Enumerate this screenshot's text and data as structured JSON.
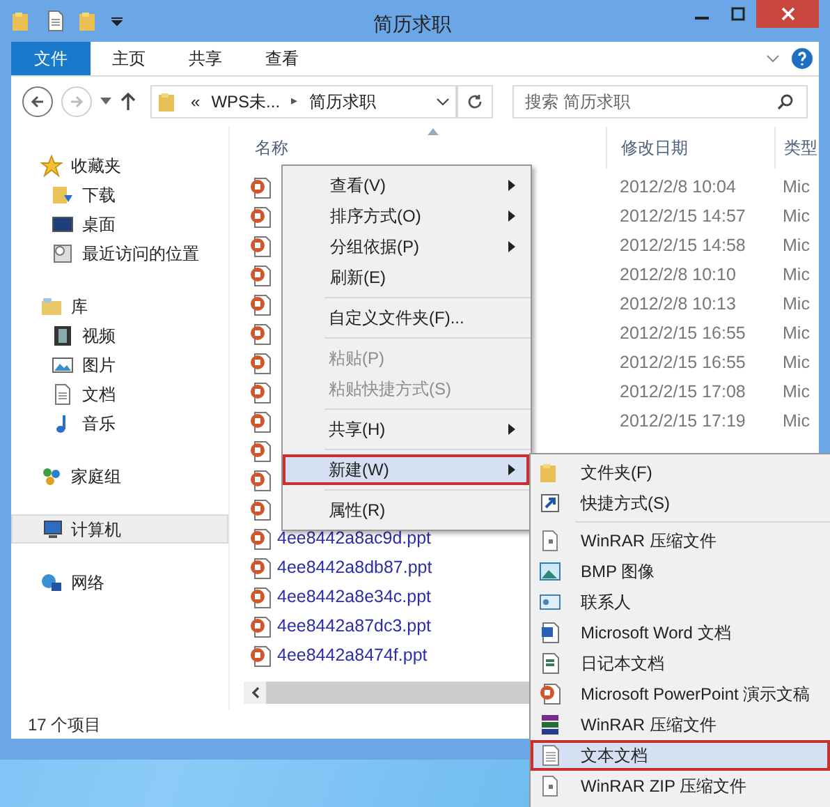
{
  "window": {
    "title": "简历求职"
  },
  "ribbon": {
    "tabs": [
      {
        "label": "文件",
        "selected": true
      },
      {
        "label": "主页",
        "selected": false
      },
      {
        "label": "共享",
        "selected": false
      },
      {
        "label": "查看",
        "selected": false
      }
    ]
  },
  "address": {
    "overflow": "«",
    "crumbs": [
      "WPS未...",
      "简历求职"
    ],
    "separator": "▸",
    "search_placeholder": "搜索 简历求职"
  },
  "nav": [
    {
      "label": "收藏夹",
      "kind": "star",
      "selected": false,
      "children": [
        {
          "label": "下载",
          "kind": "download",
          "selected": false
        },
        {
          "label": "桌面",
          "kind": "desktop",
          "selected": false
        },
        {
          "label": "最近访问的位置",
          "kind": "recent",
          "selected": false
        }
      ]
    },
    {
      "label": "库",
      "kind": "library",
      "selected": false,
      "children": [
        {
          "label": "视频",
          "kind": "video",
          "selected": false
        },
        {
          "label": "图片",
          "kind": "picture",
          "selected": false
        },
        {
          "label": "文档",
          "kind": "document",
          "selected": false
        },
        {
          "label": "音乐",
          "kind": "music",
          "selected": false
        }
      ]
    },
    {
      "label": "家庭组",
      "kind": "homegroup",
      "selected": false
    },
    {
      "label": "计算机",
      "kind": "computer",
      "selected": true
    },
    {
      "label": "网络",
      "kind": "network",
      "selected": false
    }
  ],
  "columns": [
    "名称",
    "修改日期",
    "类型"
  ],
  "files": [
    {
      "kind": "ppt",
      "date": "2012/2/8 10:04",
      "type": "Mic"
    },
    {
      "kind": "ppt",
      "date": "2012/2/15 14:57",
      "type": "Mic"
    },
    {
      "kind": "ppt",
      "date": "2012/2/15 14:58",
      "type": "Mic"
    },
    {
      "kind": "ppt",
      "date": "2012/2/8 10:10",
      "type": "Mic"
    },
    {
      "kind": "ppt",
      "date": "2012/2/8 10:13",
      "type": "Mic"
    },
    {
      "kind": "ppt",
      "date": "2012/2/15 16:55",
      "type": "Mic"
    },
    {
      "kind": "ppt",
      "date": "2012/2/15 16:55",
      "type": "Mic"
    },
    {
      "kind": "ppt",
      "date": "2012/2/15 17:08",
      "type": "Mic"
    },
    {
      "kind": "ppt",
      "date": "2012/2/15 17:19",
      "type": "Mic"
    },
    {
      "kind": "ppt"
    },
    {
      "kind": "ppt"
    },
    {
      "kind": "ppt"
    },
    {
      "kind": "ppt",
      "name": "4ee8442a8ac9d.ppt"
    },
    {
      "kind": "ppt",
      "name": "4ee8442a8db87.ppt"
    },
    {
      "kind": "ppt",
      "name": "4ee8442a8e34c.ppt"
    },
    {
      "kind": "ppt",
      "name": "4ee8442a87dc3.ppt"
    },
    {
      "kind": "ppt",
      "name": "4ee8442a8474f.ppt"
    }
  ],
  "status_bar": "17 个项目",
  "context_menu": [
    [
      {
        "label": "查看(V)",
        "submenu": true,
        "disabled": false,
        "selected": false
      },
      {
        "label": "排序方式(O)",
        "submenu": true,
        "disabled": false,
        "selected": false
      },
      {
        "label": "分组依据(P)",
        "submenu": true,
        "disabled": false,
        "selected": false
      },
      {
        "label": "刷新(E)",
        "submenu": false,
        "disabled": false,
        "selected": false
      }
    ],
    [
      {
        "label": "自定义文件夹(F)...",
        "submenu": false,
        "disabled": false,
        "selected": false
      }
    ],
    [
      {
        "label": "粘贴(P)",
        "submenu": false,
        "disabled": true,
        "selected": false
      },
      {
        "label": "粘贴快捷方式(S)",
        "submenu": false,
        "disabled": true,
        "selected": false
      }
    ],
    [
      {
        "label": "共享(H)",
        "submenu": true,
        "disabled": false,
        "selected": false
      }
    ],
    [
      {
        "label": "新建(W)",
        "submenu": true,
        "disabled": false,
        "selected": true
      }
    ],
    [
      {
        "label": "属性(R)",
        "submenu": false,
        "disabled": false,
        "selected": false
      }
    ]
  ],
  "new_submenu": [
    [
      {
        "label": "文件夹(F)",
        "kind": "folder",
        "selected": false
      },
      {
        "label": "快捷方式(S)",
        "kind": "shortcut",
        "selected": false
      }
    ],
    [
      {
        "label": "WinRAR 压缩文件",
        "kind": "archive",
        "selected": false
      },
      {
        "label": "BMP 图像",
        "kind": "image",
        "selected": false
      },
      {
        "label": "联系人",
        "kind": "contact",
        "selected": false
      },
      {
        "label": "Microsoft Word 文档",
        "kind": "word",
        "selected": false
      },
      {
        "label": "日记本文档",
        "kind": "journal",
        "selected": false
      },
      {
        "label": "Microsoft PowerPoint 演示文稿",
        "kind": "ppt",
        "selected": false
      },
      {
        "label": "WinRAR 压缩文件",
        "kind": "winrar",
        "selected": false
      },
      {
        "label": "文本文档",
        "kind": "text",
        "selected": true
      },
      {
        "label": "WinRAR ZIP 压缩文件",
        "kind": "archive",
        "selected": false
      }
    ]
  ]
}
